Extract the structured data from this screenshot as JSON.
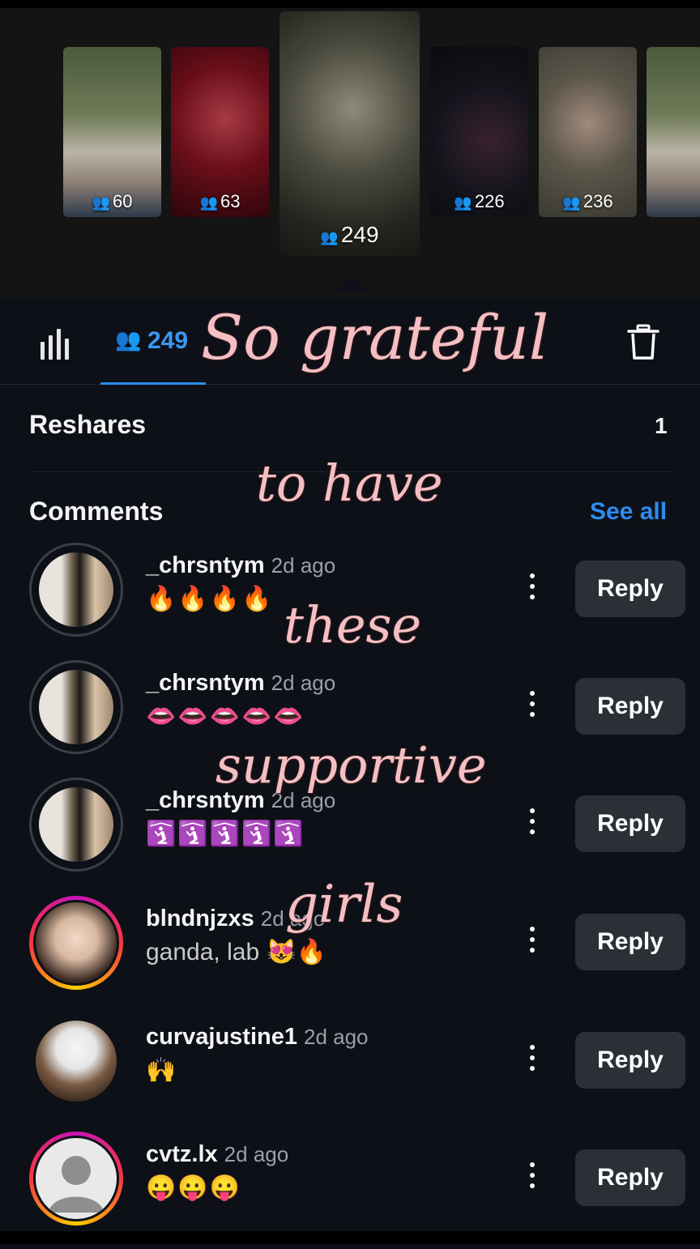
{
  "stories": [
    {
      "viewers": "60"
    },
    {
      "viewers": "63"
    },
    {
      "viewers": "249"
    },
    {
      "viewers": "226"
    },
    {
      "viewers": "236"
    }
  ],
  "tabs": {
    "viewers_count": "249"
  },
  "reshares": {
    "title": "Reshares",
    "count": "1"
  },
  "comments": {
    "title": "Comments",
    "see_all": "See all",
    "reply_label": "Reply",
    "items": [
      {
        "username": "_chrsntym",
        "time": "2d ago",
        "text": "🔥🔥🔥🔥"
      },
      {
        "username": "_chrsntym",
        "time": "2d ago",
        "text": "👄👄👄👄👄"
      },
      {
        "username": "_chrsntym",
        "time": "2d ago",
        "text": "🛐🛐🛐🛐🛐"
      },
      {
        "username": "blndnjzxs",
        "time": "2d ago",
        "text": "ganda, lab 😻🔥"
      },
      {
        "username": "curvajustine1",
        "time": "2d ago",
        "text": "🙌"
      },
      {
        "username": "cvtz.lx",
        "time": "2d ago",
        "text": "😛😛😛"
      }
    ]
  },
  "overlay_text": {
    "line1": "So grateful",
    "line2": "to have",
    "line3": "these",
    "line4": "supportive",
    "line5": "girls"
  },
  "colors": {
    "accent": "#2d8cf0",
    "background": "#0d1117",
    "overlay_text": "#f4bfc3"
  }
}
